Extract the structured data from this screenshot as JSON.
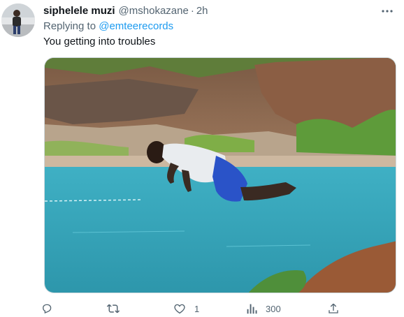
{
  "tweet": {
    "display_name": "siphelele muzi",
    "handle": "@mshokazane",
    "separator": "·",
    "time": "2h",
    "replying_prefix": "Replying to",
    "replying_to": "@emteerecords",
    "text": "You getting into troubles",
    "media_alt": "photo",
    "icons": {
      "more": "more-icon",
      "reply": "reply-icon",
      "retweet": "retweet-icon",
      "like": "like-icon",
      "views": "views-icon",
      "share": "share-icon"
    }
  },
  "actions": {
    "reply_count": "",
    "retweet_count": "",
    "like_count": "1",
    "view_count": "300"
  },
  "colors": {
    "link": "#1d9bf0",
    "secondary_text": "#536471",
    "water": "#3aa5b8"
  }
}
